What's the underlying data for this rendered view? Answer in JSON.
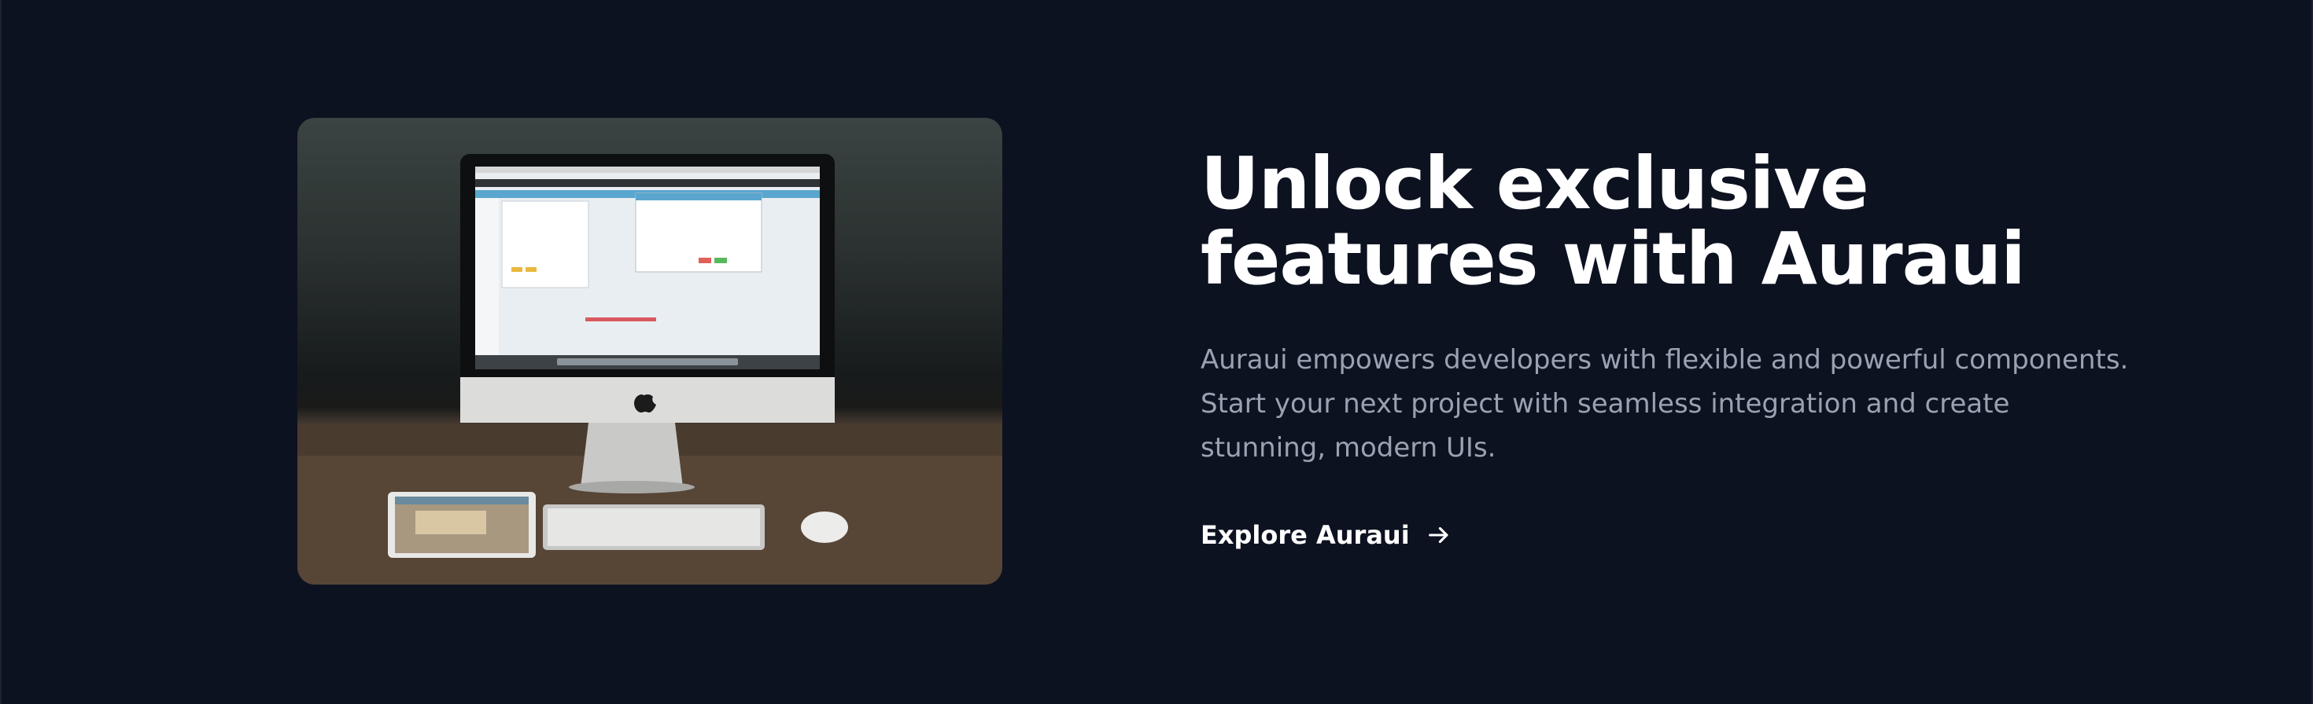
{
  "hero": {
    "image_alt": "Desktop computer with a tablet, keyboard and mouse on a wooden desk",
    "title": "Unlock exclusive features with Auraui",
    "description": "Auraui empowers developers with flexible and powerful components. Start your next project with seamless integration and create stunning, modern UIs.",
    "cta_label": "Explore Auraui",
    "cta_icon": "arrow-right-icon"
  },
  "colors": {
    "background": "#0d1221",
    "title": "#ffffff",
    "description": "#9aa1b1",
    "cta": "#ffffff"
  }
}
